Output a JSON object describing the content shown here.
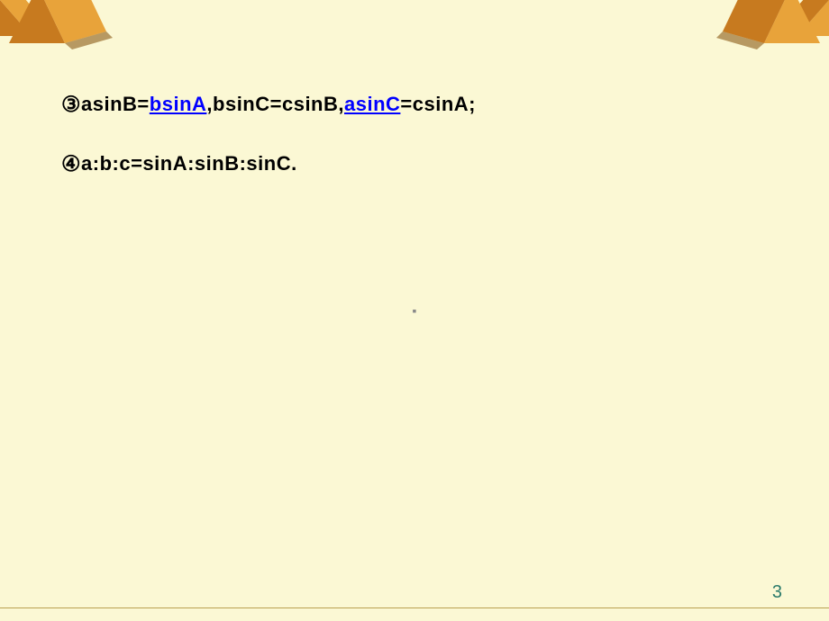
{
  "line3": {
    "marker": "③",
    "part1": "asinB=",
    "link1": "bsinA",
    "part2": ",bsinC=csinB,",
    "link2": "asinC",
    "part3": "=csinA;"
  },
  "line4": {
    "marker": "④",
    "text": "a:b:c=sinA:sinB:sinC."
  },
  "centerDot": "▪",
  "pageNumber": "3",
  "colors": {
    "pyramid_back": "#c77a1f",
    "pyramid_front": "#e8a33a",
    "pyramid_shadow": "#8b5a15"
  }
}
